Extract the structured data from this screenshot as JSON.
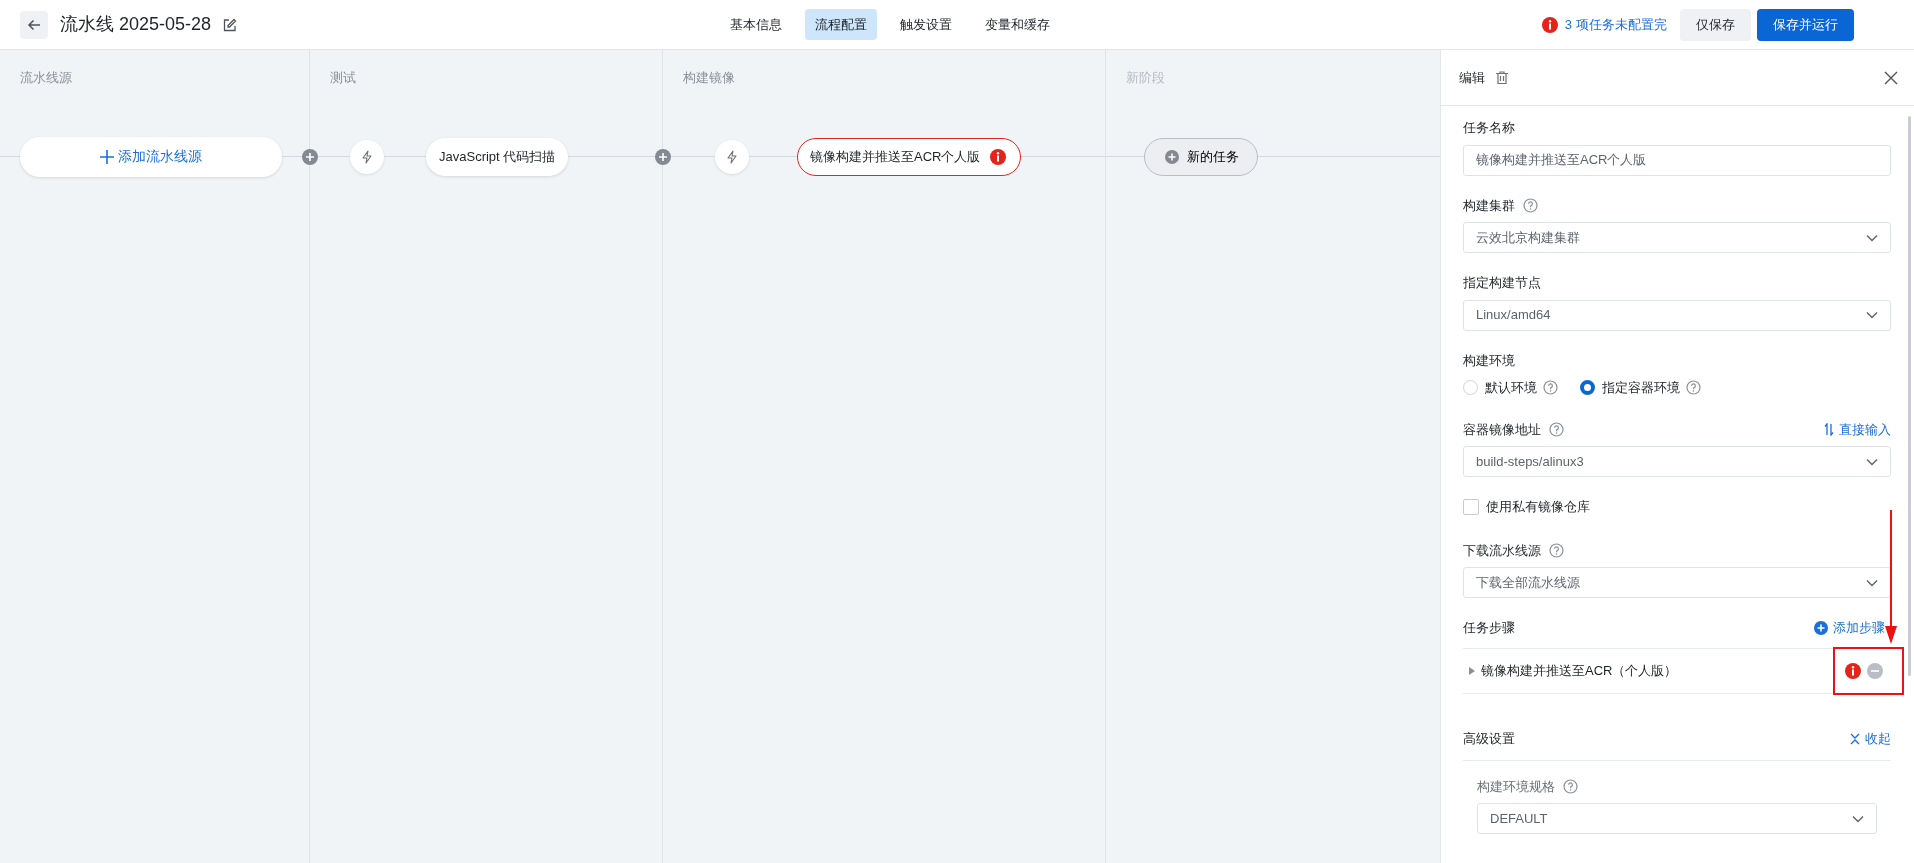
{
  "header": {
    "title": "流水线 2025-05-28",
    "tabs": [
      {
        "label": "基本信息",
        "selected": false
      },
      {
        "label": "流程配置",
        "selected": true
      },
      {
        "label": "触发设置",
        "selected": false
      },
      {
        "label": "变量和缓存",
        "selected": false
      }
    ],
    "warning": "3 项任务未配置完",
    "buttons": [
      {
        "label": "仅保存",
        "kind": "secondary"
      },
      {
        "label": "保存并运行",
        "kind": "primary"
      }
    ]
  },
  "stages": [
    {
      "title": "流水线源",
      "kind": "source",
      "button": "添加流水线源"
    },
    {
      "title": "测试",
      "kind": "task",
      "tasks": [
        {
          "label": "JavaScript 代码扫描",
          "error": false
        }
      ]
    },
    {
      "title": "构建镜像",
      "kind": "task",
      "tasks": [
        {
          "label": "镜像构建并推送至ACR个人版",
          "error": true
        }
      ]
    },
    {
      "title": "新阶段",
      "kind": "new",
      "button": "新的任务"
    }
  ],
  "panel": {
    "title": "编辑",
    "fields": [
      {
        "kind": "input",
        "label": "任务名称",
        "help": false,
        "value": "镜像构建并推送至ACR个人版"
      },
      {
        "kind": "select",
        "label": "构建集群",
        "help": true,
        "value": "云效北京构建集群"
      },
      {
        "kind": "select",
        "label": "指定构建节点",
        "help": false,
        "value": "Linux/amd64"
      },
      {
        "kind": "radio",
        "label": "构建环境",
        "help": false,
        "options": [
          {
            "label": "默认环境",
            "selected": false
          },
          {
            "label": "指定容器环境",
            "selected": true
          }
        ]
      },
      {
        "kind": "select",
        "label": "容器镜像地址",
        "help": true,
        "action": "直接输入",
        "value": "build-steps/alinux3"
      },
      {
        "kind": "checkbox",
        "label": "使用私有镜像仓库",
        "checked": false
      },
      {
        "kind": "select",
        "label": "下载流水线源",
        "help": true,
        "value": "下载全部流水线源"
      }
    ],
    "steps": {
      "label": "任务步骤",
      "action": "添加步骤",
      "items": [
        {
          "label": "镜像构建并推送至ACR（个人版）",
          "error": true
        }
      ]
    },
    "advanced": {
      "label": "高级设置",
      "action": "收起",
      "expanded": true,
      "fields": [
        {
          "kind": "select",
          "label": "构建环境规格",
          "help": true,
          "value": "DEFAULT"
        }
      ]
    }
  }
}
